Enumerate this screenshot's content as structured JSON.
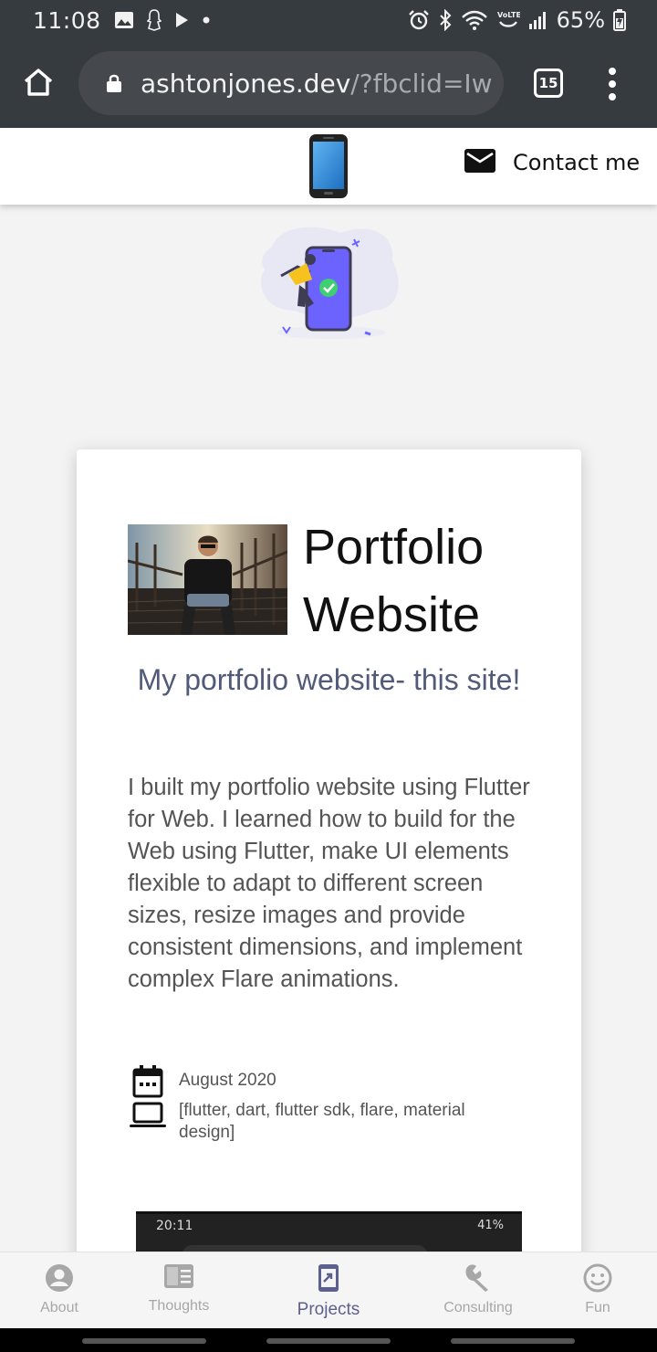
{
  "status_bar": {
    "time": "11:08",
    "battery": "65%",
    "left_icons": [
      "image-icon",
      "snapchat-like-icon",
      "play-icon",
      "dot-icon"
    ],
    "right_icons": [
      "alarm-icon",
      "bluetooth-icon",
      "wifi-icon",
      "volte-icon",
      "signal-icon",
      "battery-icon"
    ]
  },
  "browser": {
    "url_host": "ashtonjones.dev",
    "url_path": "/?fbclid=Iw",
    "tab_count": "15"
  },
  "header": {
    "contact_label": "Contact me"
  },
  "project": {
    "title": "Portfolio Website",
    "subtitle": "My portfolio website- this site!",
    "description": "I built my portfolio website using Flutter for Web. I learned how to build for the Web using Flutter, make UI elements flexible to adapt to different screen sizes, resize images and provide consistent dimensions, and implement complex Flare animations.",
    "date": "August 2020",
    "tags": "[flutter, dart, flutter sdk, flare, material design]",
    "thumb_time": "20:11",
    "thumb_battery": "41%"
  },
  "bottom_nav": {
    "items": [
      {
        "label": "About",
        "icon": "account-circle-icon"
      },
      {
        "label": "Thoughts",
        "icon": "article-icon"
      },
      {
        "label": "Projects",
        "icon": "projects-icon",
        "active": true
      },
      {
        "label": "Consulting",
        "icon": "wrench-icon"
      },
      {
        "label": "Fun",
        "icon": "smiley-icon"
      }
    ]
  },
  "colors": {
    "chrome_dark": "#363b3f",
    "accent": "#5d5f8c",
    "illustration_purple": "#6c63ff"
  }
}
